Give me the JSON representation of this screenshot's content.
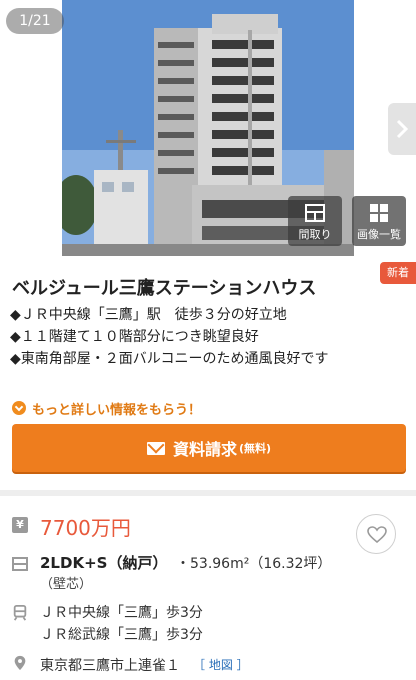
{
  "gallery": {
    "counter": "1/21",
    "floorplan_label": "間取り",
    "gallery_label": "画像一覧",
    "colors": {
      "sky": "#5c8fd0",
      "building": "#cfcfcf",
      "overlay": "#3c3c3c"
    }
  },
  "property": {
    "badge": "新着",
    "title": "ベルジュール三鷹ステーションハウス",
    "features": [
      "◆ＪＲ中央線「三鷹」駅　徒歩３分の好立地",
      "◆１１階建て１０階部分につき眺望良好",
      "◆東南角部屋・２面バルコニーのため通風良好です"
    ],
    "more_info": "もっと詳しい情報をもらう！",
    "cta_label": "資料請求",
    "cta_sub": "(無料)"
  },
  "details": {
    "yen_symbol": "¥",
    "price": "7700万円",
    "layout": "2LDK+S（納戸）",
    "area": "・53.96m²（16.32坪）",
    "wall_note": "（壁芯）",
    "access": [
      "ＪＲ中央線「三鷹」歩3分",
      "ＪＲ総武線「三鷹」歩3分"
    ],
    "address": "東京都三鷹市上連雀１",
    "map_link": "［ 地図 ］"
  },
  "colors": {
    "accent": "#ee7d1e",
    "price": "#e8593b",
    "link": "#2a6fb8"
  }
}
